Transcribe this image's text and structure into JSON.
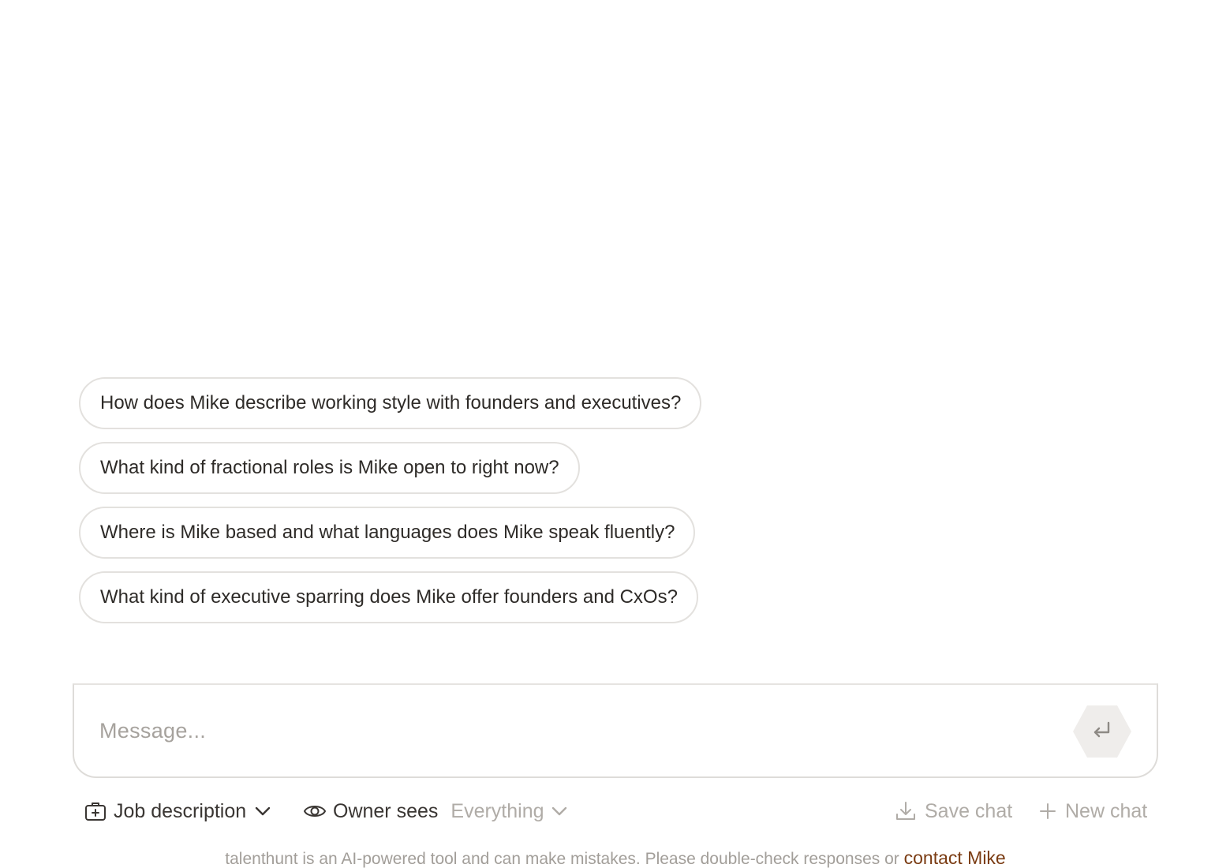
{
  "suggestions": [
    {
      "label": "How does Mike describe working style with founders and executives?"
    },
    {
      "label": "What kind of fractional roles is Mike open to right now?"
    },
    {
      "label": "Where is Mike based and what languages does Mike speak fluently?"
    },
    {
      "label": "What kind of executive sparring does Mike offer founders and CxOs?"
    }
  ],
  "composer": {
    "placeholder": "Message...",
    "value": "",
    "send_icon": "enter-return-icon"
  },
  "toolbar": {
    "job_description": {
      "label": "Job description",
      "icon": "briefcase-plus-icon"
    },
    "owner_sees": {
      "label": "Owner sees",
      "value": "Everything",
      "icon": "eye-icon"
    },
    "save_chat": {
      "label": "Save chat",
      "icon": "download-icon"
    },
    "new_chat": {
      "label": "New chat",
      "icon": "plus-icon"
    }
  },
  "footer": {
    "disclaimer": "talenthunt is an AI-powered tool and can make mistakes. Please double-check responses or ",
    "link_label": "contact Mike"
  },
  "colors": {
    "text": "#2e2b28",
    "muted": "#a29e99",
    "link": "#7a3b12",
    "chip_border": "#e3e1de",
    "send_button_bg": "#efedeb"
  }
}
